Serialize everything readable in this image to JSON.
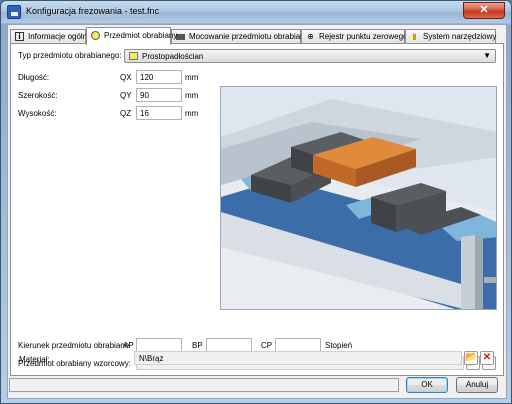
{
  "window": {
    "title": "Konfiguracja frezowania - test.fnc",
    "close_glyph": "✕"
  },
  "tabs": [
    {
      "label": "Informacje ogólne",
      "icon": "info-icon",
      "active": false
    },
    {
      "label": "Przedmiot obrabiany",
      "icon": "circle-icon",
      "active": true
    },
    {
      "label": "Mocowanie przedmiotu obrabianego",
      "icon": "vise-icon",
      "active": false
    },
    {
      "label": "Rejestr punktu zerowego",
      "icon": "crosshair-icon",
      "active": false
    },
    {
      "label": "System narzędziowy",
      "icon": "tool-icon",
      "active": false
    }
  ],
  "workpiece": {
    "type_label": "Typ przedmiotu obrabianego:",
    "type_value": "Prostopadłościan",
    "type_swatch_color": "#f5e85a",
    "length_label": "Długość:",
    "length_axis": "QX",
    "length_value": "120",
    "width_label": "Szerokość:",
    "width_axis": "QY",
    "width_value": "90",
    "height_label": "Wysokość:",
    "height_axis": "QZ",
    "height_value": "16",
    "unit": "mm"
  },
  "direction": {
    "label": "Kierunek przedmiotu obrabiane",
    "ap_label": "AP",
    "ap_value": "",
    "bp_label": "BP",
    "bp_value": "",
    "cp_label": "CP",
    "cp_value": "",
    "unit": "Stopień"
  },
  "template": {
    "label": "Przedmiot obrabiany wzorcowy:",
    "value": ""
  },
  "material": {
    "label": "Materiał:",
    "value": "N\\Brąz"
  },
  "buttons": {
    "ok": "OK",
    "cancel": "Anuluj"
  },
  "colors": {
    "workpiece": "#d9782b",
    "vise": "#4a4d52",
    "table": "#3b6ea8"
  }
}
